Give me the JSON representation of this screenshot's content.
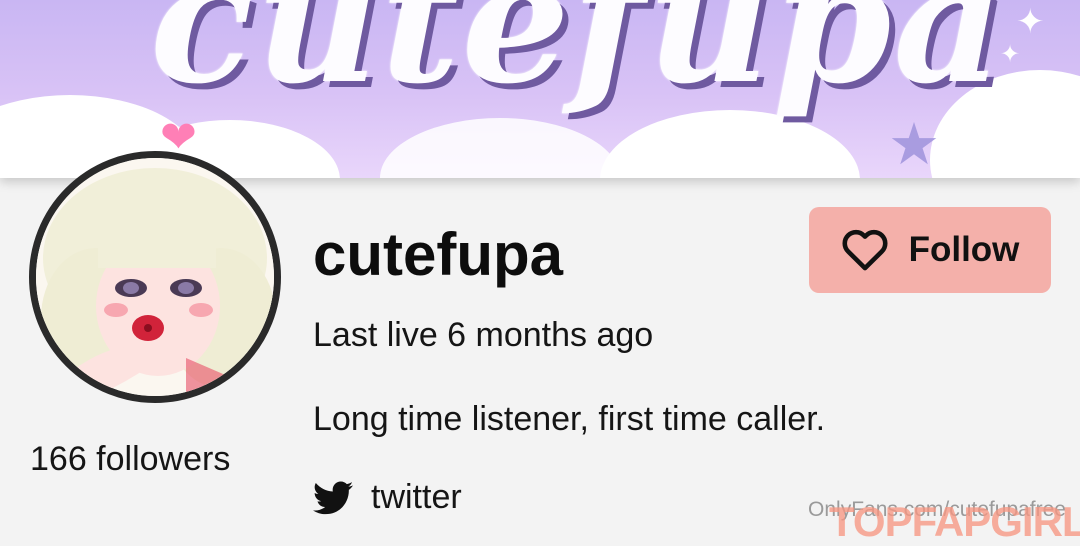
{
  "banner": {
    "title": "cutefupa"
  },
  "profile": {
    "username": "cutefupa",
    "last_live": "Last live 6 months ago",
    "bio": "Long time listener, first time caller.",
    "followers": "166 followers",
    "social": {
      "label": "twitter",
      "icon": "twitter-bird-icon"
    }
  },
  "actions": {
    "follow_label": "Follow",
    "follow_icon": "heart-outline-icon"
  },
  "watermarks": {
    "site": "OnlyFans.com/cutefupafree",
    "brand": "TOPFAPGIRLS"
  },
  "colors": {
    "banner": "#d5c0f5",
    "follow_button": "#f4b0aa",
    "background": "#f3f3f3"
  }
}
